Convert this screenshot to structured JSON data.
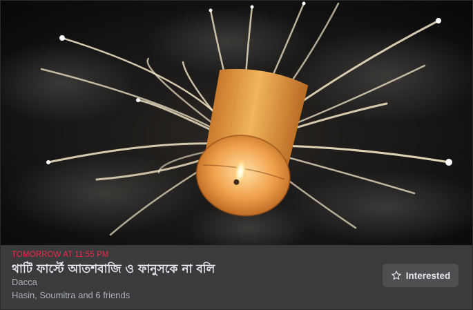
{
  "event": {
    "time_label": "TOMORROW AT 11:55 PM",
    "title": "থাটি ফার্স্টে আতশবাজি ও ফানুসকে না বলি",
    "location": "Dacca",
    "friends_going": "Hasin, Soumitra and 6 friends"
  },
  "actions": {
    "interested_label": "Interested",
    "interested_icon": "star-icon"
  },
  "colors": {
    "time_accent": "#f02849",
    "card_bg": "#3a3b3c",
    "button_bg": "#4e4f50",
    "text_primary": "#e4e6eb",
    "text_secondary": "#b0b3b8"
  }
}
